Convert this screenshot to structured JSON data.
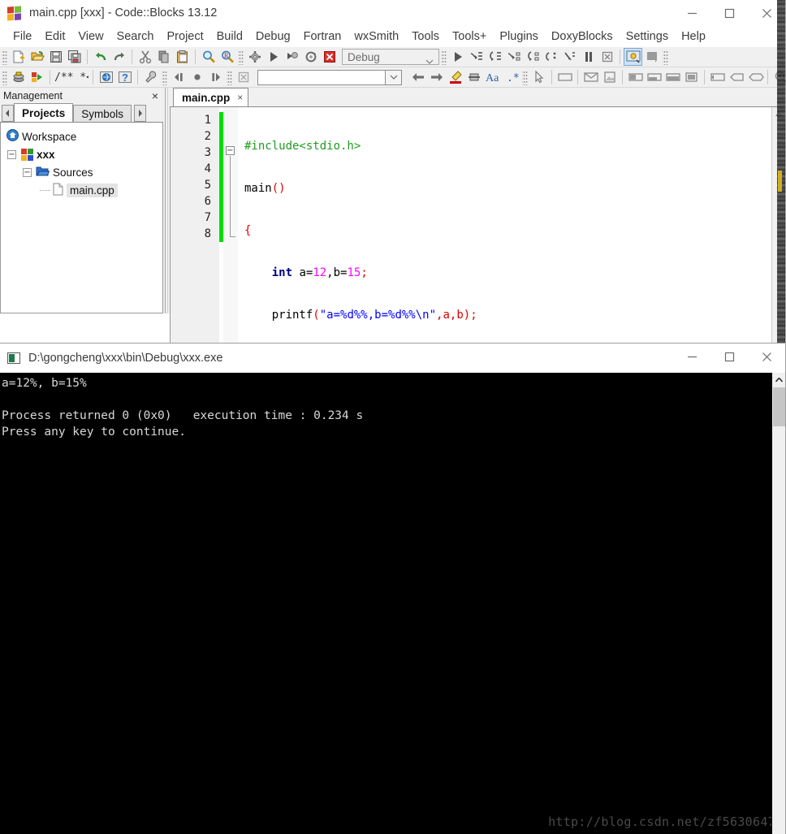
{
  "ide": {
    "title": "main.cpp [xxx] - Code::Blocks 13.12",
    "app_icon": "codeblocks-logo-icon",
    "window_controls": [
      {
        "name": "minimize-button",
        "glyph": "minimize-icon"
      },
      {
        "name": "maximize-button",
        "glyph": "maximize-icon"
      },
      {
        "name": "close-button",
        "glyph": "close-icon"
      }
    ],
    "menu": [
      "File",
      "Edit",
      "View",
      "Search",
      "Project",
      "Build",
      "Debug",
      "Fortran",
      "wxSmith",
      "Tools",
      "Tools+",
      "Plugins",
      "DoxyBlocks",
      "Settings",
      "Help"
    ],
    "toolbar_row1": [
      "new-file-icon",
      "open-file-icon",
      "save-icon",
      "save-all-icon",
      "undo-icon",
      "redo-icon",
      "cut-icon",
      "copy-icon",
      "paste-icon",
      "find-icon",
      "replace-icon",
      "build-icon",
      "run-icon",
      "build-and-run-icon",
      "rebuild-icon",
      "abort-icon"
    ],
    "build_target": "Debug",
    "toolbar_row1_debug": [
      "debug-continue-icon",
      "next-line-icon",
      "step-into-icon",
      "next-instruction-icon",
      "step-into-instruction-icon",
      "step-out-icon",
      "break-debugger-icon",
      "stop-debugger-icon",
      "debugging-windows-icon",
      "various-info-icon"
    ],
    "toolbar_row2": [
      "compile-icon",
      "compile-and-run-icon",
      "doxyblocks-comment-icon",
      "doxyblocks-run-icon",
      "doxyblocks-help-icon",
      "doxyblocks-config-icon",
      "back-icon",
      "stop-mark-icon",
      "forward-icon",
      "clear-marks-icon"
    ],
    "symbol_filter": "",
    "toolbar_row2_right": [
      "jump-back-icon",
      "jump-forward-icon",
      "highlight-icon",
      "insert-column-icon",
      "font-case-icon",
      "regex-icon",
      "pointer-icon",
      "panel-icon",
      "envelope-icon",
      "image-icon",
      "align-left-icon",
      "align-right-icon",
      "align-center-icon",
      "fill-icon",
      "expand-icon",
      "shrink-left-icon",
      "shrink-right-icon",
      "zoom-in-icon",
      "zoom-out-icon"
    ]
  },
  "management": {
    "title": "Management",
    "close_label": "×",
    "tabs": [
      {
        "label": "Projects",
        "active": true
      },
      {
        "label": "Symbols",
        "active": false
      }
    ],
    "nav_left": "◀",
    "nav_right": "▶",
    "tree": {
      "workspace": "Workspace",
      "project": "xxx",
      "folder": "Sources",
      "file": "main.cpp"
    }
  },
  "editor": {
    "tab_label": "main.cpp",
    "tab_close": "×",
    "line_numbers": [
      "1",
      "2",
      "3",
      "4",
      "5",
      "6",
      "7",
      "8"
    ],
    "code": {
      "l1_include": "#include<stdio.h>",
      "l2_main": "main",
      "l2_parens": "()",
      "l3_open": "{",
      "l4_kw": "int",
      "l4_a": " a=",
      "l4_n1": "12",
      "l4_comma": ",b=",
      "l4_n2": "15",
      "l4_semi": ";",
      "l5_fn": "printf",
      "l5_open": "(",
      "l5_str": "\"a=%d%%,b=%d%%\\n\"",
      "l5_args": ",a,b",
      "l5_close": ")",
      "l5_semi": ";",
      "l7_close": "}"
    },
    "colors": {
      "preprocessor": "#1f9b1f",
      "keyword": "#00007f",
      "number": "#ff00ff",
      "string": "#0000ff",
      "operator": "#dd0000",
      "changebar": "#00e000"
    }
  },
  "console": {
    "title": "D:\\gongcheng\\xxx\\bin\\Debug\\xxx.exe",
    "icon": "console-window-icon",
    "window_controls": [
      {
        "name": "minimize-button",
        "glyph": "minimize-icon"
      },
      {
        "name": "maximize-button",
        "glyph": "maximize-icon"
      },
      {
        "name": "close-button",
        "glyph": "close-icon"
      }
    ],
    "output": "a=12%, b=15%\n\nProcess returned 0 (0x0)   execution time : 0.234 s\nPress any key to continue.",
    "scrollbar_up": "⌃"
  },
  "watermark": "http://blog.csdn.net/zf5630647"
}
